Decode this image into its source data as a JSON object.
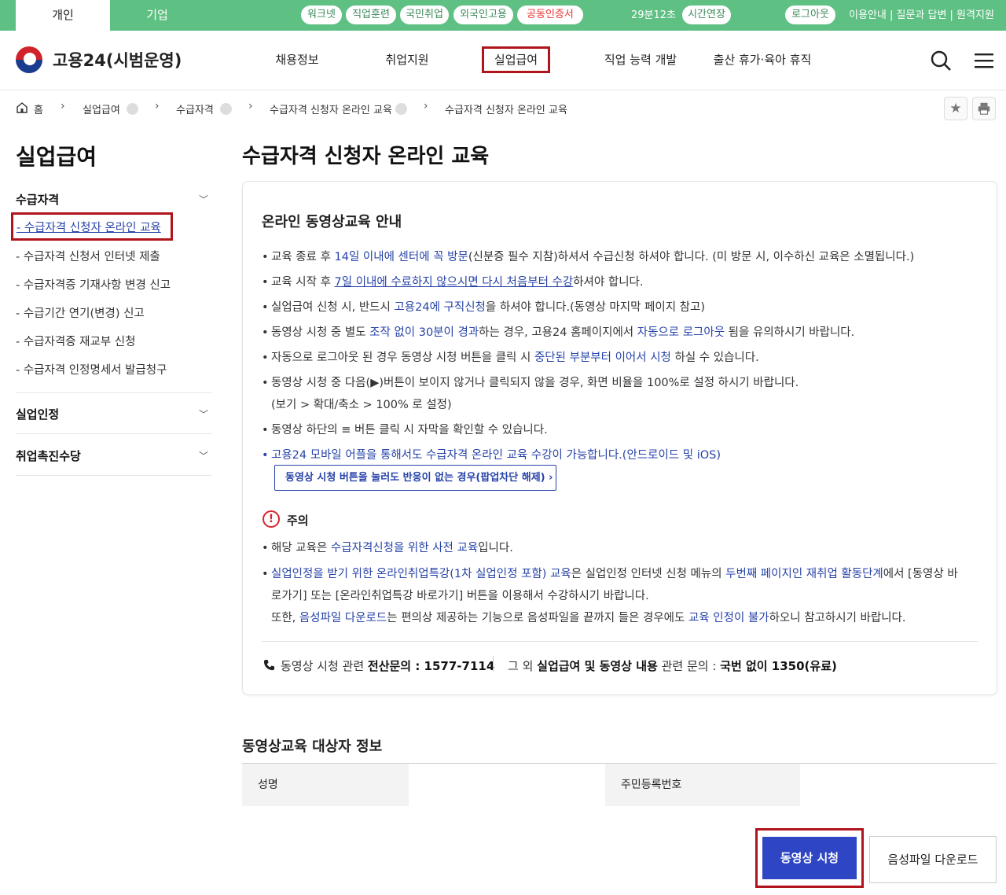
{
  "topbar": {
    "tabs": [
      "개인",
      "기업"
    ],
    "links": [
      "워크넷",
      "직업훈련",
      "국민취업",
      "외국인고용",
      "공동인증서"
    ],
    "timer": "29분12초",
    "extend": "시간연장",
    "logout": "로그아웃",
    "util": "이용안내 |  질문과 답변 | 원격지원"
  },
  "header": {
    "site_name": "고용24(시범운영)",
    "menu": [
      "채용정보",
      "취업지원",
      "실업급여",
      "직업 능력 개발",
      "출산 휴가·육아 휴직"
    ]
  },
  "breadcrumb": [
    "홈",
    "실업급여",
    "수급자격",
    "수급자격 신청자 온라인 교육",
    "수급자격 신청자 온라인 교육"
  ],
  "sidebar": {
    "title": "실업급여",
    "group1": "수급자격",
    "items": [
      "- 수급자격 신청자 온라인 교육",
      "- 수급자격 신청서 인터넷 제출",
      "- 수급자격증 기재사항 변경 신고",
      "- 수급기간 연기(변경) 신고",
      "- 수급자격증 재교부 신청",
      "- 수급자격 인정명세서 발급청구"
    ],
    "group2": "실업인정",
    "group3": "취업촉진수당"
  },
  "main": {
    "title": "수급자격 신청자 온라인 교육",
    "panel_title": "온라인 동영상교육 안내",
    "b1": [
      "교육 종료 후 ",
      "14일 이내에 센터에 꼭 방문",
      "(신분증 필수 지참)하셔서 수급신청 하셔야 합니다. (미 방문 시, 이수하신 교육은 소멸됩니다.)"
    ],
    "b2": [
      "교육 시작 후 ",
      "7일 이내에 수료하지 않으시면 다시 처음부터 수강",
      "하셔야 합니다."
    ],
    "b3": [
      "실업급여 신청 시, 반드시 ",
      "고용24에 구직신청",
      "을 하셔야 합니다.(동영상 마지막 페이지 참고)"
    ],
    "b4": [
      "동영상 시청 중 별도 ",
      "조작 없이 30분이 경과",
      "하는 경우, 고용24 홈페이지에서 ",
      "자동으로 로그아웃",
      " 됨을 유의하시기 바랍니다."
    ],
    "b5": [
      "자동으로 로그아웃 된 경우 동영상 시청 버튼을 클릭 시 ",
      "중단된 부분부터 이어서 시청",
      " 하실 수 있습니다."
    ],
    "b6": "동영상 시청 중 다음(▶)버튼이 보이지 않거나 클릭되지 않을 경우, 화면 비율을 100%로 설정 하시기 바랍니다.",
    "b6b": "(보기 > 확대/축소 > 100% 로 설정)",
    "b7": "동영상 하단의 ≡ 버튼 클릭 시 자막을 확인할 수 있습니다.",
    "b8": "고용24 모바일 어플을 통해서도 수급자격 온라인 교육 수강이 가능합니다.(안드로이드 및 iOS)",
    "popup_btn": "동영상 시청 버튼을 눌러도 반응이 없는 경우(팝업차단 해제)",
    "warn_title": "주의",
    "w1": [
      "해당 교육은 ",
      "수급자격신청을 위한 사전 교육",
      "입니다."
    ],
    "w2": [
      "실업인정을 받기 위한 온라인취업특강(1차 실업인정 포함) 교육",
      "은 실업인정 인터넷 신청 메뉴의 ",
      "두번째 페이지인 재취업 활동단계",
      "에서 [동영상 바"
    ],
    "w2b": "로가기] 또는 [온라인취업특강 바로가기] 버튼을 이용해서 수강하시기 바랍니다.",
    "w3": [
      "또한, ",
      "음성파일 다운로드",
      "는 편의상 제공하는 기능으로 음성파일을 끝까지 들은 경우에도 ",
      "교육 인정이 불가",
      "하오니 참고하시기 바랍니다."
    ],
    "contact1": [
      "동영상 시청 관련 ",
      "전산문의 : 1577-7114"
    ],
    "contact2": [
      "그 외 ",
      "실업급여 및 동영상 내용",
      " 관련 문의 : ",
      "국번 없이 1350(유료)"
    ]
  },
  "target": {
    "title": "동영상교육 대상자 정보",
    "name_label": "성명",
    "rrn_label": "주민등록번호"
  },
  "buttons": {
    "play": "동영상 시청",
    "audio": "음성파일 다운로드"
  }
}
